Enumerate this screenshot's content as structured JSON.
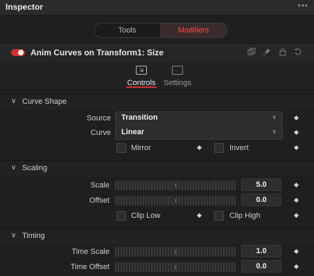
{
  "window": {
    "title": "Inspector",
    "menu_label": "•••"
  },
  "toggle": {
    "tools_label": "Tools",
    "modifiers_label": "Modifiers",
    "active": "Modifiers"
  },
  "header": {
    "name": "Anim Curves on Transform1: Size"
  },
  "tabs": [
    {
      "label": "Controls",
      "active": true
    },
    {
      "label": "Settings",
      "active": false
    }
  ],
  "sections": {
    "curve_shape": {
      "label": "Curve Shape",
      "source_label": "Source",
      "source_value": "Transition",
      "curve_label": "Curve",
      "curve_value": "Linear",
      "mirror_label": "Mirror",
      "invert_label": "Invert"
    },
    "scaling": {
      "label": "Scaling",
      "scale_label": "Scale",
      "scale_value": "5.0",
      "offset_label": "Offset",
      "offset_value": "0.0",
      "cliplow_label": "Clip Low",
      "cliphigh_label": "Clip High"
    },
    "timing": {
      "label": "Timing",
      "timescale_label": "Time Scale",
      "timescale_value": "1.0",
      "timeoffset_label": "Time Offset",
      "timeoffset_value": "0.0"
    }
  },
  "icons": {
    "chev": "⌄",
    "dd_chev": "⌄",
    "controls_tab": "⇲",
    "settings_tab": "⚙",
    "header_icons": [
      "copy-icon",
      "pin-icon",
      "lock-icon",
      "reset-icon"
    ]
  },
  "colors": {
    "accent": "#d52f2f",
    "bg": "#1f1f21"
  }
}
